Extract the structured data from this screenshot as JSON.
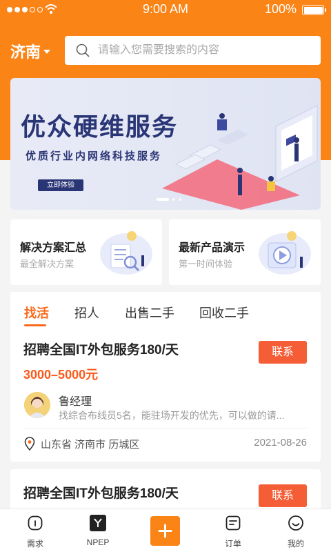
{
  "status_bar": {
    "time": "9:00 AM",
    "battery": "100%"
  },
  "header": {
    "city": "济南",
    "search_placeholder": "请输入您需要搜索的内容"
  },
  "banner": {
    "title": "优众硬维服务",
    "subtitle": "优质行业内网络科技服务",
    "button": "立即体验",
    "slides": 3,
    "active_slide": 1
  },
  "cards": [
    {
      "title": "解决方案汇总",
      "subtitle": "最全解决方案"
    },
    {
      "title": "最新产品演示",
      "subtitle": "第一时间体验"
    }
  ],
  "tabs": [
    "找活",
    "招人",
    "出售二手",
    "回收二手"
  ],
  "active_tab": 0,
  "jobs": [
    {
      "title": "招聘全国IT外包服务180/天",
      "salary": "3000–5000元",
      "contact": "联系",
      "poster_name": "鲁经理",
      "poster_desc": "找综合布线员5名，能驻场开发的优先，可以做的请...",
      "location": "山东省 济南市 历城区",
      "date": "2021-08-26"
    },
    {
      "title": "招聘全国IT外包服务180/天",
      "contact": "联系"
    }
  ],
  "tabbar": [
    {
      "label": "需求",
      "icon": "house-icon"
    },
    {
      "label": "NPEP",
      "icon": "npep-logo-icon"
    },
    {
      "label": "",
      "icon": "plus-icon"
    },
    {
      "label": "订单",
      "icon": "order-list-icon"
    },
    {
      "label": "我的",
      "icon": "smiley-profile-icon"
    }
  ],
  "colors": {
    "primary_orange": "#fb8417",
    "accent_red": "#f45d35",
    "banner_navy": "#2a3576"
  }
}
